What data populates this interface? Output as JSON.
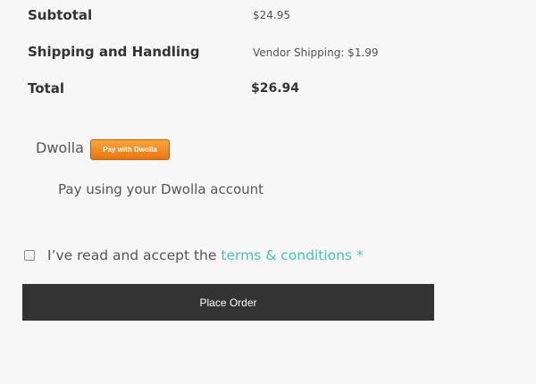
{
  "totals": {
    "subtotal_label": "Subtotal",
    "subtotal_value": "$24.95",
    "shipping_label": "Shipping and Handling",
    "shipping_value": "Vendor Shipping: $1.99",
    "total_label": "Total",
    "total_value": "$26.94"
  },
  "payment": {
    "method_name": "Dwolla",
    "badge_text": "Pay with Dwolla",
    "description": "Pay using your Dwolla account"
  },
  "terms": {
    "checked": false,
    "text": "I’ve read and accept the",
    "link_text": "terms & conditions",
    "required_mark": "*"
  },
  "place_order": {
    "label": "Place Order"
  },
  "colors": {
    "link": "#4fc1b4",
    "button_bg": "#333333",
    "badge_orange": "#f08a1e"
  }
}
